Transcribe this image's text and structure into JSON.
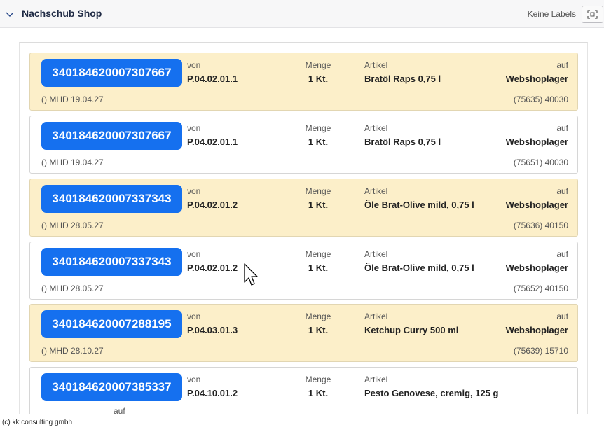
{
  "header": {
    "title": "Nachschub Shop",
    "no_labels": "Keine Labels"
  },
  "cards": [
    {
      "sscc": "340184620007307667",
      "von_label": "von",
      "von": "P.04.02.01.1",
      "menge_label": "Menge",
      "menge": "1 Kt.",
      "artikel_label": "Artikel",
      "artikel": "Bratöl Raps 0,75 l",
      "auf_label": "auf",
      "auf": "Webshoplager",
      "info": "()  MHD 19.04.27",
      "ref": "(75635) 40030",
      "highlight": true
    },
    {
      "sscc": "340184620007307667",
      "von_label": "von",
      "von": "P.04.02.01.1",
      "menge_label": "Menge",
      "menge": "1 Kt.",
      "artikel_label": "Artikel",
      "artikel": "Bratöl Raps 0,75 l",
      "auf_label": "auf",
      "auf": "Webshoplager",
      "info": "()  MHD 19.04.27",
      "ref": "(75651) 40030",
      "highlight": false
    },
    {
      "sscc": "340184620007337343",
      "von_label": "von",
      "von": "P.04.02.01.2",
      "menge_label": "Menge",
      "menge": "1 Kt.",
      "artikel_label": "Artikel",
      "artikel": "Öle Brat-Olive mild, 0,75 l",
      "auf_label": "auf",
      "auf": "Webshoplager",
      "info": "()  MHD 28.05.27",
      "ref": "(75636) 40150",
      "highlight": true
    },
    {
      "sscc": "340184620007337343",
      "von_label": "von",
      "von": "P.04.02.01.2",
      "menge_label": "Menge",
      "menge": "1 Kt.",
      "artikel_label": "Artikel",
      "artikel": "Öle Brat-Olive mild, 0,75 l",
      "auf_label": "auf",
      "auf": "Webshoplager",
      "info": "()  MHD 28.05.27",
      "ref": "(75652) 40150",
      "highlight": false
    },
    {
      "sscc": "340184620007288195",
      "von_label": "von",
      "von": "P.04.03.01.3",
      "menge_label": "Menge",
      "menge": "1 Kt.",
      "artikel_label": "Artikel",
      "artikel": "Ketchup Curry 500 ml",
      "auf_label": "auf",
      "auf": "Webshoplager",
      "info": "()  MHD 28.10.27",
      "ref": "(75639) 15710",
      "highlight": true
    },
    {
      "sscc": "340184620007385337",
      "von_label": "von",
      "von": "P.04.10.01.2",
      "menge_label": "Menge",
      "menge": "1 Kt.",
      "artikel_label": "Artikel",
      "artikel": "Pesto Genovese, cremig, 125 g",
      "auf_label": "",
      "auf": "",
      "info": "",
      "ref": "",
      "highlight": false
    }
  ],
  "partial_auf_label": "auf",
  "footer": {
    "copyright": "(c) kk consulting gmbh"
  },
  "colors": {
    "accent": "#1570ef",
    "highlight_row": "#fcefc9"
  }
}
